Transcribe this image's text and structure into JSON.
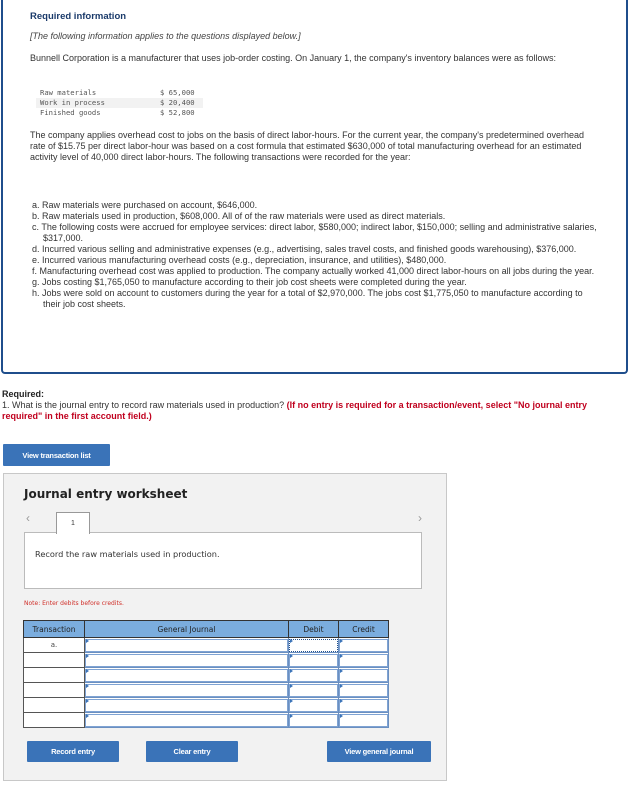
{
  "info": {
    "title": "Required information",
    "italic_note": "[The following information applies to the questions displayed below.]",
    "intro": "Bunnell Corporation is a manufacturer that uses job-order costing. On January 1, the company's inventory balances were as follows:",
    "balances": [
      {
        "label": "Raw materials",
        "value": "$ 65,000"
      },
      {
        "label": "Work in process",
        "value": "$ 20,400"
      },
      {
        "label": "Finished goods",
        "value": "$ 52,800"
      }
    ],
    "overhead_paragraph": "The company applies overhead cost to jobs on the basis of direct labor-hours. For the current year, the company's predetermined overhead rate of $15.75 per direct labor-hour was based on a cost formula that estimated $630,000 of total manufacturing overhead for an estimated activity level of 40,000 direct labor-hours. The following transactions were recorded for the year:",
    "transactions": [
      "a. Raw materials were purchased on account, $646,000.",
      "b. Raw materials used in production, $608,000. All of of the raw materials were used as direct materials.",
      "c. The following costs were accrued for employee services: direct labor, $580,000; indirect labor, $150,000; selling and administrative salaries, $317,000.",
      "d. Incurred various selling and administrative expenses (e.g., advertising, sales travel costs, and finished goods warehousing), $376,000.",
      "e. Incurred various manufacturing overhead costs (e.g., depreciation, insurance, and utilities), $480,000.",
      "f. Manufacturing overhead cost was applied to production. The company actually worked 41,000 direct labor-hours on all jobs during the year.",
      "g. Jobs costing $1,765,050 to manufacture according to their job cost sheets were completed during the year.",
      "h. Jobs were sold on account to customers during the year for a total of $2,970,000. The jobs cost $1,775,050 to manufacture according to their job cost sheets."
    ]
  },
  "required": {
    "label": "Required:",
    "question": "1. What is the journal entry to record raw materials used in production? ",
    "note": "(If no entry is required for a transaction/event, select \"No journal entry required\" in the first account field.)"
  },
  "buttons": {
    "view_transaction_list": "View transaction list",
    "record_entry": "Record entry",
    "clear_entry": "Clear entry",
    "view_general_journal": "View general journal"
  },
  "worksheet": {
    "title": "Journal entry worksheet",
    "prev_icon": "‹",
    "next_icon": "›",
    "current_tab": "1",
    "description": "Record the raw materials used in production.",
    "note": "Note: Enter debits before credits.",
    "columns": [
      "Transaction",
      "General Journal",
      "Debit",
      "Credit"
    ],
    "rows": [
      {
        "transaction": "a.",
        "account": "",
        "debit": "",
        "credit": ""
      },
      {
        "transaction": "",
        "account": "",
        "debit": "",
        "credit": ""
      },
      {
        "transaction": "",
        "account": "",
        "debit": "",
        "credit": ""
      },
      {
        "transaction": "",
        "account": "",
        "debit": "",
        "credit": ""
      },
      {
        "transaction": "",
        "account": "",
        "debit": "",
        "credit": ""
      },
      {
        "transaction": "",
        "account": "",
        "debit": "",
        "credit": ""
      }
    ]
  }
}
